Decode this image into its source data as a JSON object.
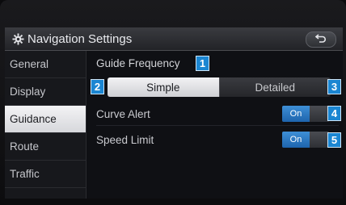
{
  "window": {
    "title": "Navigation Settings"
  },
  "sidebar": {
    "items": [
      {
        "label": "General"
      },
      {
        "label": "Display"
      },
      {
        "label": "Guidance",
        "active": true
      },
      {
        "label": "Route"
      },
      {
        "label": "Traffic"
      }
    ]
  },
  "main": {
    "guide_frequency": {
      "label": "Guide Frequency",
      "options": [
        "Simple",
        "Detailed"
      ],
      "selected": "Simple"
    },
    "curve_alert": {
      "label": "Curve Alert",
      "toggle": "On"
    },
    "speed_limit": {
      "label": "Speed Limit",
      "toggle": "On"
    }
  },
  "callouts": [
    "1",
    "2",
    "3",
    "4",
    "5"
  ],
  "icons": {
    "title_icon": "gear-icon",
    "back_icon": "back-arrow-icon"
  },
  "colors": {
    "accent": "#1e64ad",
    "callout": "#1b86d2",
    "active_tab": "#e9eaee"
  }
}
